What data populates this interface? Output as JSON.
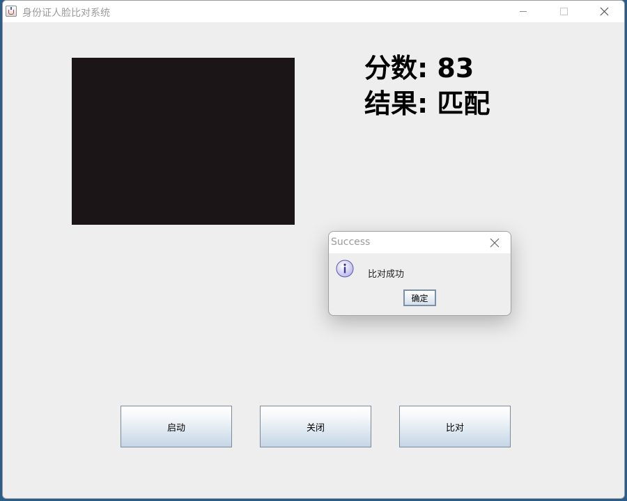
{
  "window": {
    "title": "身份证人脸比对系统",
    "controls": {
      "minimize_icon": "minimize-icon",
      "maximize_icon": "maximize-icon",
      "close_icon": "close-icon"
    }
  },
  "main": {
    "score_line": "分数: 83",
    "result_line": "结果: 匹配"
  },
  "buttons": {
    "start": "启动",
    "stop": "关闭",
    "compare": "比对"
  },
  "dialog": {
    "title": "Success",
    "message": "比对成功",
    "ok_label": "确定",
    "icon": "info-icon"
  },
  "colors": {
    "camera_background": "#1c1518",
    "button_gradient_bottom": "#c5d6e6"
  }
}
